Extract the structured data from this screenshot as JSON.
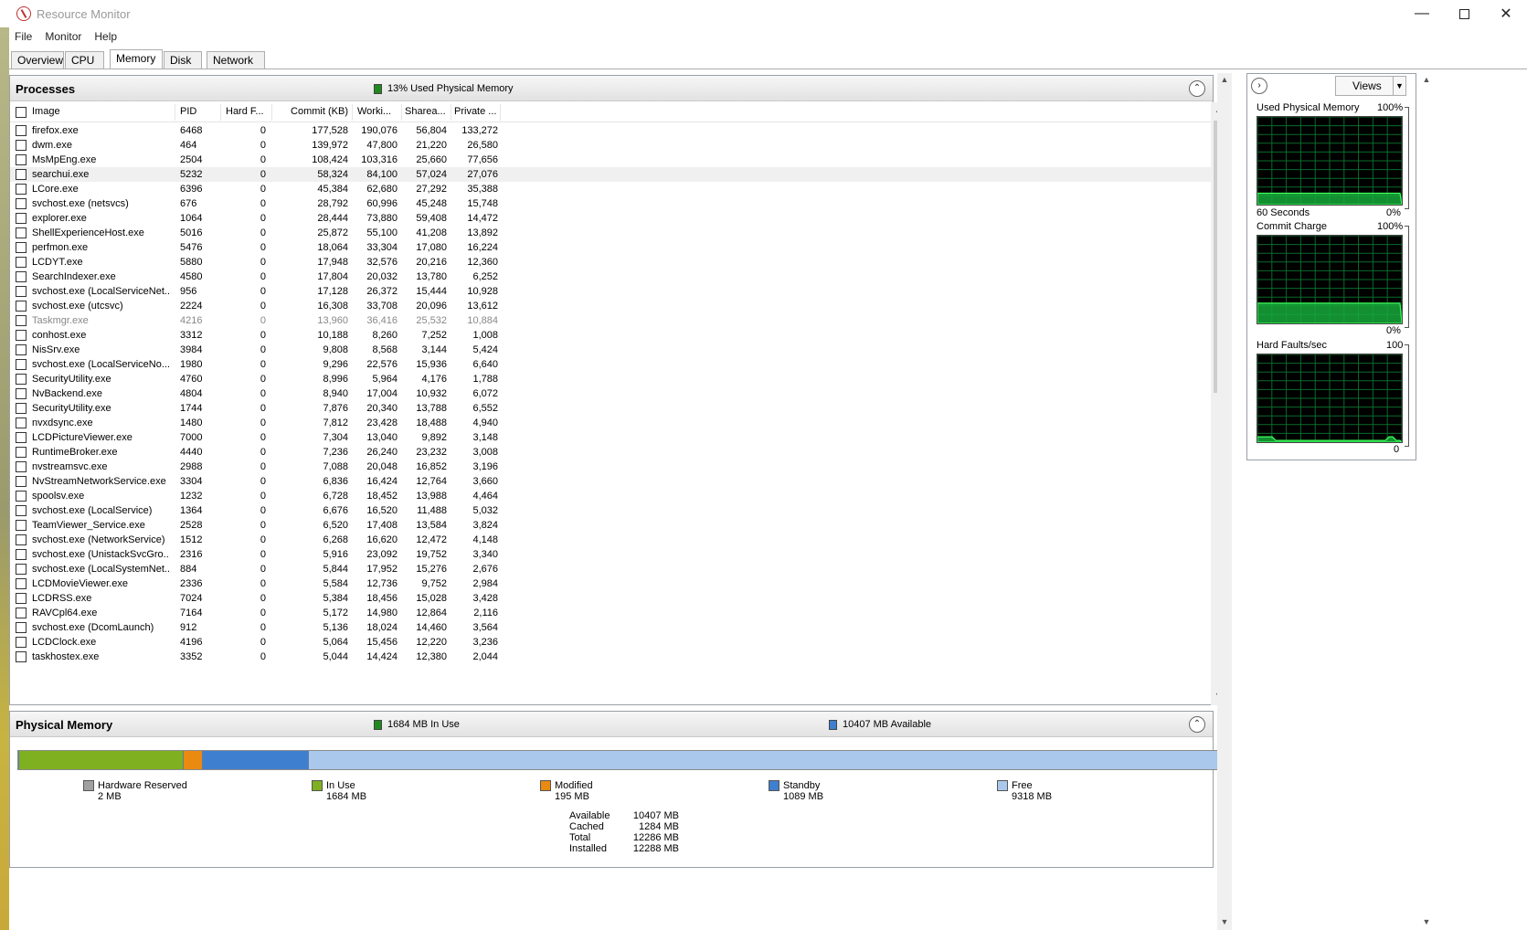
{
  "window": {
    "title": "Resource Monitor"
  },
  "menu": [
    "File",
    "Monitor",
    "Help"
  ],
  "tabs": [
    "Overview",
    "CPU",
    "Memory",
    "Disk",
    "Network"
  ],
  "active_tab": "Memory",
  "processes": {
    "title": "Processes",
    "summary": "13% Used Physical Memory",
    "summary_color": "#1f8a1f",
    "columns": [
      "Image",
      "PID",
      "Hard F...",
      "Commit (KB)",
      "Worki...",
      "Sharea...",
      "Private ..."
    ],
    "rows": [
      {
        "image": "firefox.exe",
        "pid": "6468",
        "hard": "0",
        "commit": "177,528",
        "working": "190,076",
        "shareable": "56,804",
        "private": "133,272"
      },
      {
        "image": "dwm.exe",
        "pid": "464",
        "hard": "0",
        "commit": "139,972",
        "working": "47,800",
        "shareable": "21,220",
        "private": "26,580"
      },
      {
        "image": "MsMpEng.exe",
        "pid": "2504",
        "hard": "0",
        "commit": "108,424",
        "working": "103,316",
        "shareable": "25,660",
        "private": "77,656"
      },
      {
        "image": "searchui.exe",
        "pid": "5232",
        "hard": "0",
        "commit": "58,324",
        "working": "84,100",
        "shareable": "57,024",
        "private": "27,076"
      },
      {
        "image": "LCore.exe",
        "pid": "6396",
        "hard": "0",
        "commit": "45,384",
        "working": "62,680",
        "shareable": "27,292",
        "private": "35,388"
      },
      {
        "image": "svchost.exe (netsvcs)",
        "pid": "676",
        "hard": "0",
        "commit": "28,792",
        "working": "60,996",
        "shareable": "45,248",
        "private": "15,748"
      },
      {
        "image": "explorer.exe",
        "pid": "1064",
        "hard": "0",
        "commit": "28,444",
        "working": "73,880",
        "shareable": "59,408",
        "private": "14,472"
      },
      {
        "image": "ShellExperienceHost.exe",
        "pid": "5016",
        "hard": "0",
        "commit": "25,872",
        "working": "55,100",
        "shareable": "41,208",
        "private": "13,892"
      },
      {
        "image": "perfmon.exe",
        "pid": "5476",
        "hard": "0",
        "commit": "18,064",
        "working": "33,304",
        "shareable": "17,080",
        "private": "16,224"
      },
      {
        "image": "LCDYT.exe",
        "pid": "5880",
        "hard": "0",
        "commit": "17,948",
        "working": "32,576",
        "shareable": "20,216",
        "private": "12,360"
      },
      {
        "image": "SearchIndexer.exe",
        "pid": "4580",
        "hard": "0",
        "commit": "17,804",
        "working": "20,032",
        "shareable": "13,780",
        "private": "6,252"
      },
      {
        "image": "svchost.exe (LocalServiceNet...",
        "pid": "956",
        "hard": "0",
        "commit": "17,128",
        "working": "26,372",
        "shareable": "15,444",
        "private": "10,928"
      },
      {
        "image": "svchost.exe (utcsvc)",
        "pid": "2224",
        "hard": "0",
        "commit": "16,308",
        "working": "33,708",
        "shareable": "20,096",
        "private": "13,612"
      },
      {
        "image": "Taskmgr.exe",
        "pid": "4216",
        "hard": "0",
        "commit": "13,960",
        "working": "36,416",
        "shareable": "25,532",
        "private": "10,884"
      },
      {
        "image": "conhost.exe",
        "pid": "3312",
        "hard": "0",
        "commit": "10,188",
        "working": "8,260",
        "shareable": "7,252",
        "private": "1,008"
      },
      {
        "image": "NisSrv.exe",
        "pid": "3984",
        "hard": "0",
        "commit": "9,808",
        "working": "8,568",
        "shareable": "3,144",
        "private": "5,424"
      },
      {
        "image": "svchost.exe (LocalServiceNo...",
        "pid": "1980",
        "hard": "0",
        "commit": "9,296",
        "working": "22,576",
        "shareable": "15,936",
        "private": "6,640"
      },
      {
        "image": "SecurityUtility.exe",
        "pid": "4760",
        "hard": "0",
        "commit": "8,996",
        "working": "5,964",
        "shareable": "4,176",
        "private": "1,788"
      },
      {
        "image": "NvBackend.exe",
        "pid": "4804",
        "hard": "0",
        "commit": "8,940",
        "working": "17,004",
        "shareable": "10,932",
        "private": "6,072"
      },
      {
        "image": "SecurityUtility.exe",
        "pid": "1744",
        "hard": "0",
        "commit": "7,876",
        "working": "20,340",
        "shareable": "13,788",
        "private": "6,552"
      },
      {
        "image": "nvxdsync.exe",
        "pid": "1480",
        "hard": "0",
        "commit": "7,812",
        "working": "23,428",
        "shareable": "18,488",
        "private": "4,940"
      },
      {
        "image": "LCDPictureViewer.exe",
        "pid": "7000",
        "hard": "0",
        "commit": "7,304",
        "working": "13,040",
        "shareable": "9,892",
        "private": "3,148"
      },
      {
        "image": "RuntimeBroker.exe",
        "pid": "4440",
        "hard": "0",
        "commit": "7,236",
        "working": "26,240",
        "shareable": "23,232",
        "private": "3,008"
      },
      {
        "image": "nvstreamsvc.exe",
        "pid": "2988",
        "hard": "0",
        "commit": "7,088",
        "working": "20,048",
        "shareable": "16,852",
        "private": "3,196"
      },
      {
        "image": "NvStreamNetworkService.exe",
        "pid": "3304",
        "hard": "0",
        "commit": "6,836",
        "working": "16,424",
        "shareable": "12,764",
        "private": "3,660"
      },
      {
        "image": "spoolsv.exe",
        "pid": "1232",
        "hard": "0",
        "commit": "6,728",
        "working": "18,452",
        "shareable": "13,988",
        "private": "4,464"
      },
      {
        "image": "svchost.exe (LocalService)",
        "pid": "1364",
        "hard": "0",
        "commit": "6,676",
        "working": "16,520",
        "shareable": "11,488",
        "private": "5,032"
      },
      {
        "image": "TeamViewer_Service.exe",
        "pid": "2528",
        "hard": "0",
        "commit": "6,520",
        "working": "17,408",
        "shareable": "13,584",
        "private": "3,824"
      },
      {
        "image": "svchost.exe (NetworkService)",
        "pid": "1512",
        "hard": "0",
        "commit": "6,268",
        "working": "16,620",
        "shareable": "12,472",
        "private": "4,148"
      },
      {
        "image": "svchost.exe (UnistackSvcGro...",
        "pid": "2316",
        "hard": "0",
        "commit": "5,916",
        "working": "23,092",
        "shareable": "19,752",
        "private": "3,340"
      },
      {
        "image": "svchost.exe (LocalSystemNet...",
        "pid": "884",
        "hard": "0",
        "commit": "5,844",
        "working": "17,952",
        "shareable": "15,276",
        "private": "2,676"
      },
      {
        "image": "LCDMovieViewer.exe",
        "pid": "2336",
        "hard": "0",
        "commit": "5,584",
        "working": "12,736",
        "shareable": "9,752",
        "private": "2,984"
      },
      {
        "image": "LCDRSS.exe",
        "pid": "7024",
        "hard": "0",
        "commit": "5,384",
        "working": "18,456",
        "shareable": "15,028",
        "private": "3,428"
      },
      {
        "image": "RAVCpl64.exe",
        "pid": "7164",
        "hard": "0",
        "commit": "5,172",
        "working": "14,980",
        "shareable": "12,864",
        "private": "2,116"
      },
      {
        "image": "svchost.exe (DcomLaunch)",
        "pid": "912",
        "hard": "0",
        "commit": "5,136",
        "working": "18,024",
        "shareable": "14,460",
        "private": "3,564"
      },
      {
        "image": "LCDClock.exe",
        "pid": "4196",
        "hard": "0",
        "commit": "5,064",
        "working": "15,456",
        "shareable": "12,220",
        "private": "3,236"
      },
      {
        "image": "taskhostex.exe",
        "pid": "3352",
        "hard": "0",
        "commit": "5,044",
        "working": "14,424",
        "shareable": "12,380",
        "private": "2,044"
      }
    ],
    "highlighted_row": "searchui.exe",
    "dimmed_row": "Taskmgr.exe"
  },
  "physical_memory": {
    "title": "Physical Memory",
    "in_use_summary": "1684 MB In Use",
    "available_summary": "10407 MB Available",
    "segments": [
      {
        "name": "Hardware Reserved",
        "value": "2 MB",
        "mb": 2,
        "color": "#a0a0a0"
      },
      {
        "name": "In Use",
        "value": "1684 MB",
        "mb": 1684,
        "color": "#7fb01f"
      },
      {
        "name": "Modified",
        "value": "195 MB",
        "mb": 195,
        "color": "#ea8a10"
      },
      {
        "name": "Standby",
        "value": "1089 MB",
        "mb": 1089,
        "color": "#3f7fd0"
      },
      {
        "name": "Free",
        "value": "9318 MB",
        "mb": 9318,
        "color": "#a9c8ec"
      }
    ],
    "stats": [
      {
        "label": "Available",
        "value": "10407 MB"
      },
      {
        "label": "Cached",
        "value": "1284 MB"
      },
      {
        "label": "Total",
        "value": "12286 MB"
      },
      {
        "label": "Installed",
        "value": "12288 MB"
      }
    ]
  },
  "graphs": {
    "views_label": "Views",
    "panels": [
      {
        "title": "Used Physical Memory",
        "max": "100%",
        "bottom_left": "60 Seconds",
        "bottom_right": "0%",
        "level": 0.13
      },
      {
        "title": "Commit Charge",
        "max": "100%",
        "bottom_left": "",
        "bottom_right": "0%",
        "level": 0.23
      },
      {
        "title": "Hard Faults/sec",
        "max": "100",
        "bottom_left": "",
        "bottom_right": "0",
        "level": 0.02
      }
    ]
  }
}
